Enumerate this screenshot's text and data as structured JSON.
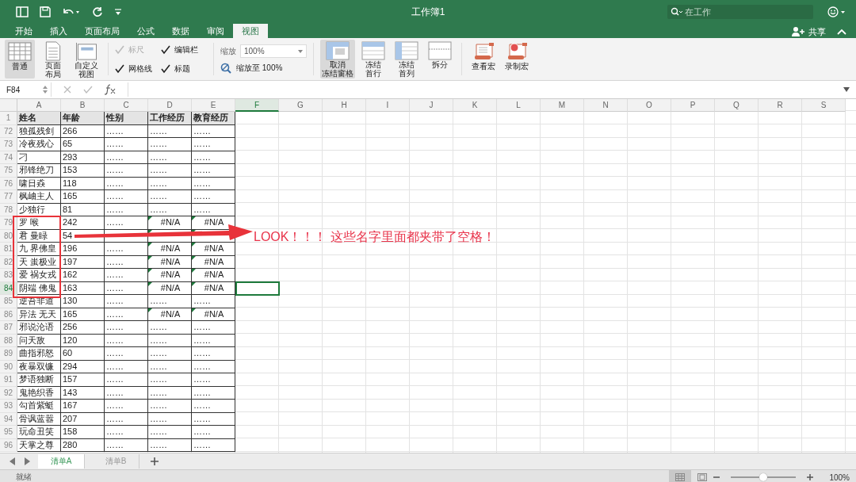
{
  "title_bar": {
    "title": "工作簿1",
    "search": {
      "placeholder": "在工作"
    }
  },
  "tabs": [
    {
      "label": "开始",
      "selected": false
    },
    {
      "label": "插入",
      "selected": false
    },
    {
      "label": "页面布局",
      "selected": false
    },
    {
      "label": "公式",
      "selected": false
    },
    {
      "label": "数据",
      "selected": false
    },
    {
      "label": "审阅",
      "selected": false
    },
    {
      "label": "视图",
      "selected": true
    }
  ],
  "share": {
    "label": "共享"
  },
  "ribbon": {
    "views": [
      {
        "lines": [
          "普通"
        ],
        "kind": "normal",
        "selected": true
      },
      {
        "lines": [
          "页面",
          "布局"
        ],
        "kind": "page",
        "selected": false
      },
      {
        "lines": [
          "自定义",
          "视图"
        ],
        "kind": "custom",
        "selected": false
      }
    ],
    "show": [
      {
        "label": "标尺",
        "checked": true,
        "disabled": true
      },
      {
        "label": "编辑栏",
        "checked": true,
        "disabled": false
      },
      {
        "label": "网格线",
        "checked": true,
        "disabled": false
      },
      {
        "label": "标题",
        "checked": true,
        "disabled": false
      }
    ],
    "zoom": {
      "label": "缩放",
      "value": "100%",
      "fit_label": "缩放至 100%"
    },
    "freeze": [
      {
        "lines": [
          "取消",
          "冻结窗格"
        ],
        "kind": "unfreeze",
        "selected": true
      },
      {
        "lines": [
          "冻结",
          "首行"
        ],
        "kind": "row",
        "selected": false
      },
      {
        "lines": [
          "冻结",
          "首列"
        ],
        "kind": "col",
        "selected": false
      },
      {
        "lines": [
          "拆分"
        ],
        "kind": "split",
        "selected": false
      }
    ],
    "macros": [
      {
        "label": "查看宏",
        "kind": "view"
      },
      {
        "label": "录制宏",
        "kind": "record"
      }
    ]
  },
  "formula_bar": {
    "name_box": "F84"
  },
  "columns": [
    {
      "label": "A",
      "selected": false
    },
    {
      "label": "B",
      "selected": false
    },
    {
      "label": "C",
      "selected": false
    },
    {
      "label": "D",
      "selected": false
    },
    {
      "label": "E",
      "selected": false
    },
    {
      "label": "F",
      "selected": true
    },
    {
      "label": "G",
      "selected": false
    },
    {
      "label": "H",
      "selected": false
    },
    {
      "label": "I",
      "selected": false
    },
    {
      "label": "J",
      "selected": false
    },
    {
      "label": "K",
      "selected": false
    },
    {
      "label": "L",
      "selected": false
    },
    {
      "label": "M",
      "selected": false
    },
    {
      "label": "N",
      "selected": false
    },
    {
      "label": "O",
      "selected": false
    },
    {
      "label": "P",
      "selected": false
    },
    {
      "label": "Q",
      "selected": false
    },
    {
      "label": "R",
      "selected": false
    },
    {
      "label": "S",
      "selected": false
    }
  ],
  "header_row": {
    "number": "1",
    "cells": [
      "姓名",
      "年龄",
      "性别",
      "工作经历",
      "教育经历"
    ]
  },
  "rows": [
    {
      "number": "72",
      "selected": false,
      "flagged": false,
      "cells": [
        "独孤残剑",
        "266",
        "……",
        "……",
        "……"
      ]
    },
    {
      "number": "73",
      "selected": false,
      "flagged": false,
      "cells": [
        "冷夜残心",
        "65",
        "……",
        "……",
        "……"
      ]
    },
    {
      "number": "74",
      "selected": false,
      "flagged": false,
      "cells": [
        "刁",
        "293",
        "……",
        "……",
        "……"
      ]
    },
    {
      "number": "75",
      "selected": false,
      "flagged": false,
      "cells": [
        "邪锋绝刀",
        "153",
        "……",
        "……",
        "……"
      ]
    },
    {
      "number": "76",
      "selected": false,
      "flagged": false,
      "cells": [
        "啸日猋",
        "118",
        "……",
        "……",
        "……"
      ]
    },
    {
      "number": "77",
      "selected": false,
      "flagged": false,
      "cells": [
        "枫岫主人",
        "165",
        "……",
        "……",
        "……"
      ]
    },
    {
      "number": "78",
      "selected": false,
      "flagged": false,
      "cells": [
        "少独行",
        "81",
        "……",
        "……",
        "……"
      ]
    },
    {
      "number": "79",
      "selected": false,
      "flagged": true,
      "cells": [
        "罗 喉",
        "242",
        "……",
        "#N/A",
        "#N/A"
      ]
    },
    {
      "number": "80",
      "selected": false,
      "flagged": true,
      "cells": [
        "君 曼睩",
        "54"
      ]
    },
    {
      "number": "81",
      "selected": false,
      "flagged": true,
      "cells": [
        "九 界佛皇",
        "196",
        "……",
        "#N/A",
        "#N/A"
      ]
    },
    {
      "number": "82",
      "selected": false,
      "flagged": true,
      "cells": [
        "天 蚩极业",
        "197",
        "……",
        "#N/A",
        "#N/A"
      ]
    },
    {
      "number": "83",
      "selected": false,
      "flagged": true,
      "cells": [
        "爱 祸女戎",
        "162",
        "……",
        "#N/A",
        "#N/A"
      ]
    },
    {
      "number": "84",
      "selected": true,
      "flagged": true,
      "cells": [
        "阴端 佛鬼",
        "163",
        "……",
        "#N/A",
        "#N/A"
      ]
    },
    {
      "number": "85",
      "selected": false,
      "flagged": false,
      "cells": [
        "逆吾非道",
        "130",
        "……",
        "……",
        "……"
      ]
    },
    {
      "number": "86",
      "selected": false,
      "flagged": true,
      "cells": [
        "异法 无天",
        "165",
        "……",
        "#N/A",
        "#N/A"
      ]
    },
    {
      "number": "87",
      "selected": false,
      "flagged": false,
      "cells": [
        "邪说沦语",
        "256",
        "……",
        "……",
        "……"
      ]
    },
    {
      "number": "88",
      "selected": false,
      "flagged": false,
      "cells": [
        "问天敌",
        "120",
        "……",
        "……",
        "……"
      ]
    },
    {
      "number": "89",
      "selected": false,
      "flagged": false,
      "cells": [
        "曲指邪怒",
        "60",
        "……",
        "……",
        "……"
      ]
    },
    {
      "number": "90",
      "selected": false,
      "flagged": false,
      "cells": [
        "夜暴双镰",
        "294",
        "……",
        "……",
        "……"
      ]
    },
    {
      "number": "91",
      "selected": false,
      "flagged": false,
      "cells": [
        "梦语独断",
        "157",
        "……",
        "……",
        "……"
      ]
    },
    {
      "number": "92",
      "selected": false,
      "flagged": false,
      "cells": [
        "鬼艳织香",
        "143",
        "……",
        "……",
        "……"
      ]
    },
    {
      "number": "93",
      "selected": false,
      "flagged": false,
      "cells": [
        "勾首紫蜓",
        "167",
        "……",
        "……",
        "……"
      ]
    },
    {
      "number": "94",
      "selected": false,
      "flagged": false,
      "cells": [
        "骨讽蓝嚣",
        "207",
        "……",
        "……",
        "……"
      ]
    },
    {
      "number": "95",
      "selected": false,
      "flagged": false,
      "cells": [
        "玩命丑笑",
        "158",
        "……",
        "……",
        "……"
      ]
    },
    {
      "number": "96",
      "selected": false,
      "flagged": false,
      "cells": [
        "天掌之尊",
        "280",
        "……",
        "……",
        "……"
      ]
    }
  ],
  "annotation": {
    "text": "LOOK！！！ 这些名字里面都夹带了空格！"
  },
  "sheets": [
    {
      "label": "清单A",
      "selected": true
    },
    {
      "label": "清单B",
      "selected": false
    }
  ],
  "status_bar": {
    "status": "就绪",
    "views": [
      {
        "kind": "normal",
        "selected": true
      },
      {
        "kind": "page",
        "selected": false
      }
    ],
    "zoom": {
      "level": 0.5,
      "reading": "100%"
    }
  }
}
